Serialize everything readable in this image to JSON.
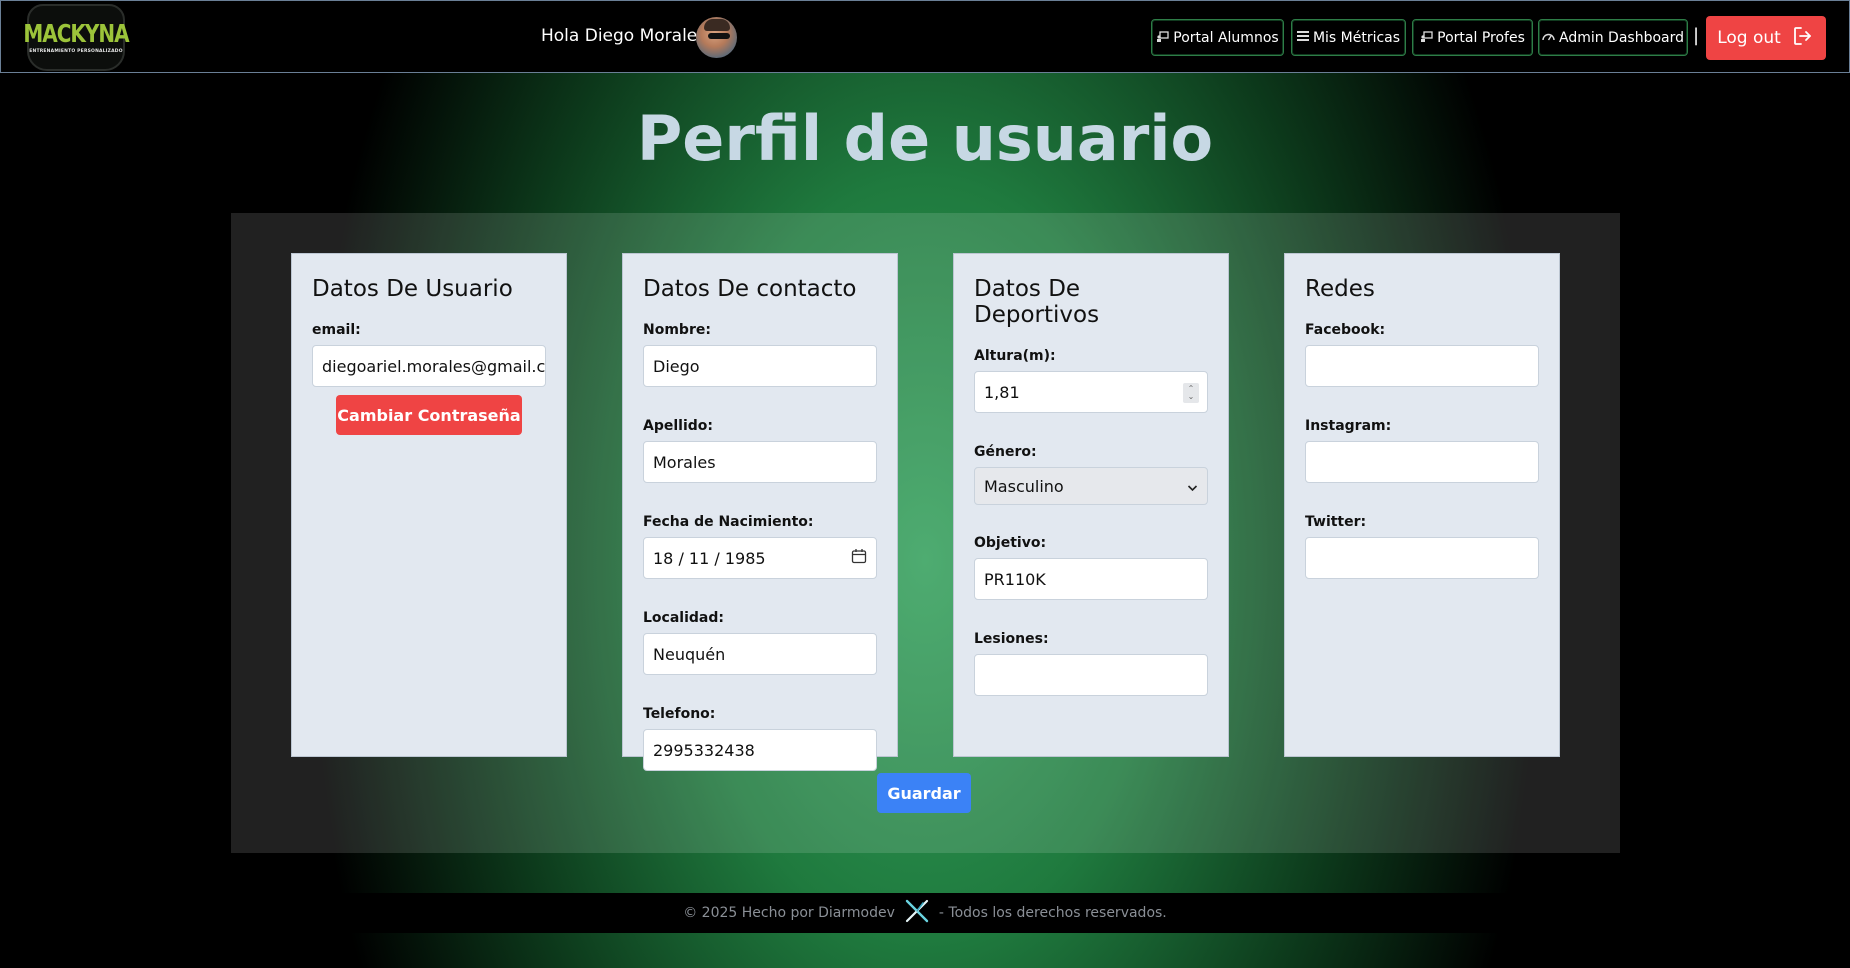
{
  "header": {
    "logo_title": "MACKYNA",
    "logo_subtitle": "ENTRENAMIENTO PERSONALIZADO",
    "greeting": "Hola Diego Morales!",
    "nav": [
      {
        "label": "Portal Alumnos",
        "icon": "person-board-icon"
      },
      {
        "label": "Mis Métricas",
        "icon": "list-icon"
      },
      {
        "label": "Portal Profes",
        "icon": "person-board-icon"
      },
      {
        "label": "Admin Dashboard",
        "icon": "gauge-icon"
      }
    ],
    "separator": "|",
    "logout_label": "Log out"
  },
  "main": {
    "title": "Perfil de usuario",
    "cards": {
      "usuario": {
        "title": "Datos De Usuario",
        "email_label": "email:",
        "email_value": "diegoariel.morales@gmail.com",
        "change_password_label": "Cambiar Contraseña"
      },
      "contacto": {
        "title": "Datos De contacto",
        "nombre_label": "Nombre:",
        "nombre_value": "Diego",
        "apellido_label": "Apellido:",
        "apellido_value": "Morales",
        "fecha_label": "Fecha de Nacimiento:",
        "fecha_value": "18 / 11 / 1985",
        "localidad_label": "Localidad:",
        "localidad_value": "Neuquén",
        "telefono_label": "Telefono:",
        "telefono_value": "2995332438"
      },
      "deportivos": {
        "title": "Datos De Deportivos",
        "altura_label": "Altura(m):",
        "altura_value": "1,81",
        "genero_label": "Género:",
        "genero_value": "Masculino",
        "objetivo_label": "Objetivo:",
        "objetivo_value": "PR110K",
        "lesiones_label": "Lesiones:",
        "lesiones_value": ""
      },
      "redes": {
        "title": "Redes",
        "facebook_label": "Facebook:",
        "facebook_value": "",
        "instagram_label": "Instagram:",
        "instagram_value": "",
        "twitter_label": "Twitter:",
        "twitter_value": ""
      }
    },
    "save_label": "Guardar"
  },
  "footer": {
    "left_text": "© 2025 Hecho por Diarmodev",
    "right_text": "- Todos los derechos reservados."
  },
  "colors": {
    "accent_red": "#ef4444",
    "accent_blue": "#3b82f6",
    "card_bg": "#e2e8f0",
    "title_color": "#c7d8e4",
    "logo_green": "#9cc43a"
  }
}
